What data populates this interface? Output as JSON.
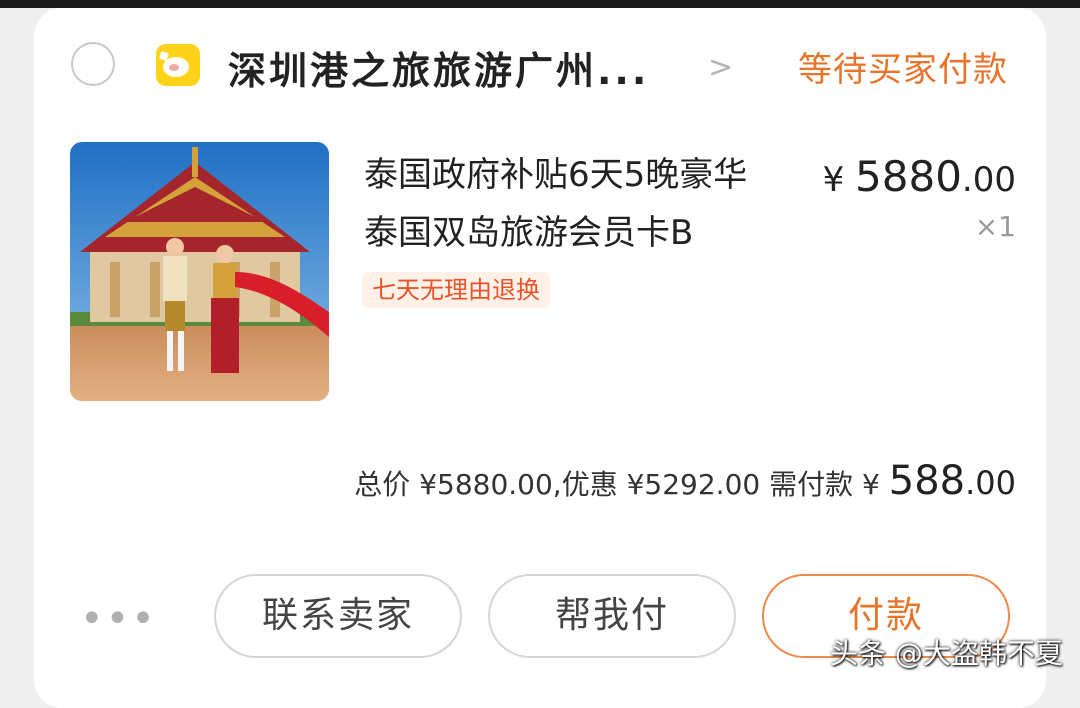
{
  "order": {
    "shop_name": "深圳港之旅旅游广州...",
    "status": "等待买家付款",
    "product_title_line1": "泰国政府补贴6天5晚豪华",
    "product_title_line2": "泰国双岛旅游会员卡B",
    "currency_symbol": "¥",
    "price_integer": "5880",
    "price_decimal": ".00",
    "quantity": "×1",
    "tag": "七天无理由退换",
    "summary_text": "总价 ¥5880.00,优惠 ¥5292.00 需付款",
    "pay_integer": "588",
    "pay_decimal": ".00"
  },
  "actions": {
    "more": "•••",
    "contact_seller": "联系卖家",
    "help_pay": "帮我付",
    "pay": "付款"
  },
  "watermark": "头条 @大盗韩不夏",
  "colors": {
    "accent": "#e8742a",
    "tag_bg": "#fff0e8",
    "logo_yellow": "#ffd21a"
  }
}
